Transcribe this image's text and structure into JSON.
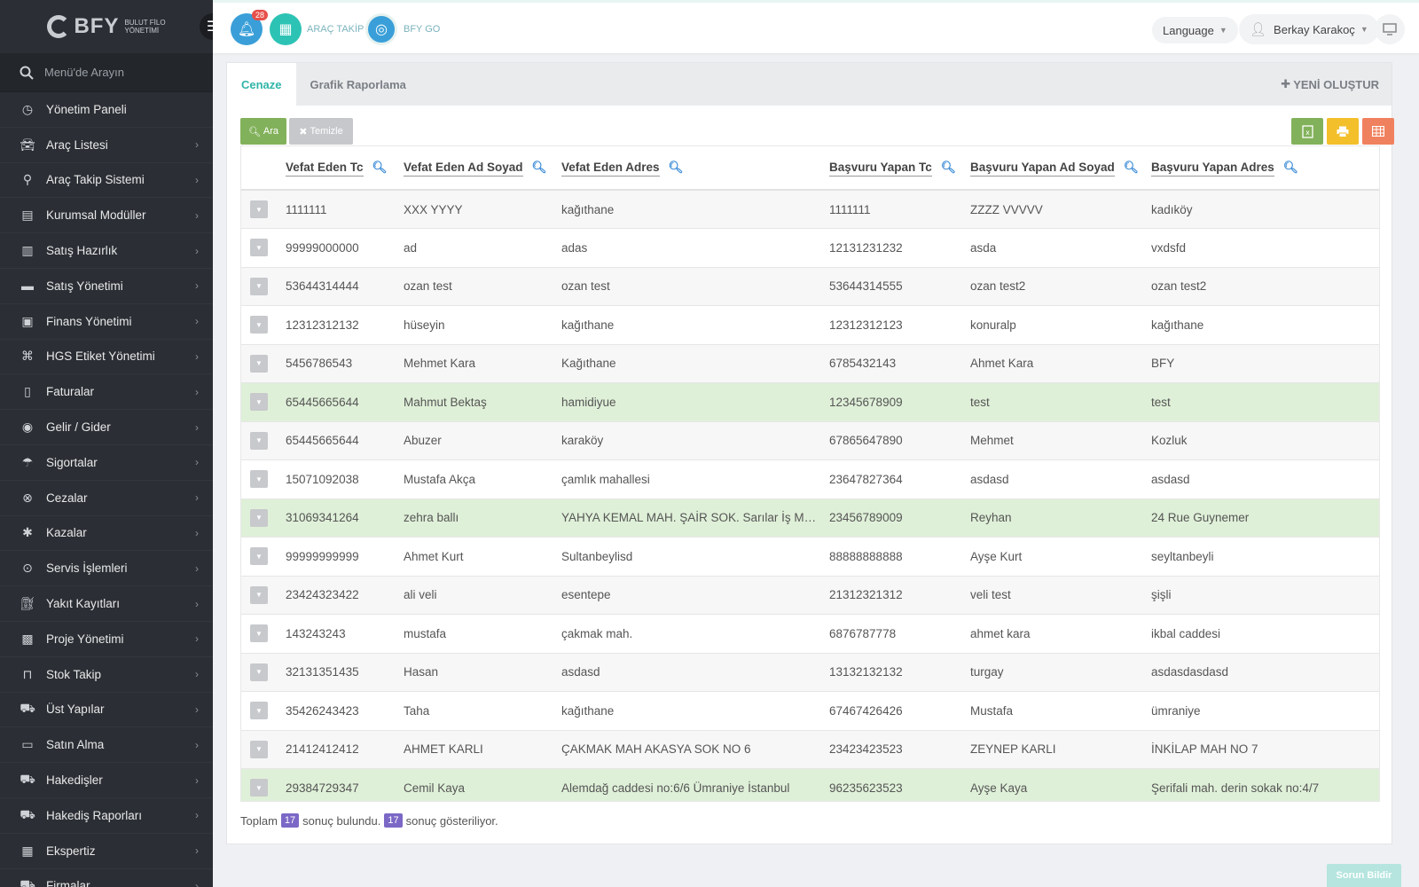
{
  "logo": {
    "text": "BFY",
    "sub1": "BULUT FİLO",
    "sub2": "YÖNETİMİ"
  },
  "sidebar": {
    "search_placeholder": "Menü'de Arayın",
    "items": [
      {
        "label": "Yönetim Paneli",
        "icon": "dashboard-icon",
        "chevron": false
      },
      {
        "label": "Araç Listesi",
        "icon": "car-icon",
        "chevron": true
      },
      {
        "label": "Araç Takip Sistemi",
        "icon": "map-pin-icon",
        "chevron": true
      },
      {
        "label": "Kurumsal Modüller",
        "icon": "server-icon",
        "chevron": true
      },
      {
        "label": "Satış Hazırlık",
        "icon": "book-icon",
        "chevron": true
      },
      {
        "label": "Satış Yönetimi",
        "icon": "card-icon",
        "chevron": true
      },
      {
        "label": "Finans Yönetimi",
        "icon": "money-icon",
        "chevron": true
      },
      {
        "label": "HGS Etiket Yönetimi",
        "icon": "tag-icon",
        "chevron": true
      },
      {
        "label": "Faturalar",
        "icon": "file-icon",
        "chevron": true
      },
      {
        "label": "Gelir / Gider",
        "icon": "coin-icon",
        "chevron": true
      },
      {
        "label": "Sigortalar",
        "icon": "umbrella-icon",
        "chevron": true
      },
      {
        "label": "Cezalar",
        "icon": "x-circle-icon",
        "chevron": true
      },
      {
        "label": "Kazalar",
        "icon": "car-crash-icon",
        "chevron": true
      },
      {
        "label": "Servis İşlemleri",
        "icon": "check-circle-icon",
        "chevron": true
      },
      {
        "label": "Yakıt Kayıtları",
        "icon": "fuel-icon",
        "chevron": true
      },
      {
        "label": "Proje Yönetimi",
        "icon": "briefcase-icon",
        "chevron": true
      },
      {
        "label": "Stok Takip",
        "icon": "inbox-icon",
        "chevron": true
      },
      {
        "label": "Üst Yapılar",
        "icon": "truck-icon",
        "chevron": true
      },
      {
        "label": "Satın Alma",
        "icon": "credit-card-icon",
        "chevron": true
      },
      {
        "label": "Hakedişler",
        "icon": "truck-icon",
        "chevron": true
      },
      {
        "label": "Hakediş Raporları",
        "icon": "truck-icon",
        "chevron": true
      },
      {
        "label": "Ekspertiz",
        "icon": "report-icon",
        "chevron": true
      },
      {
        "label": "Firmalar",
        "icon": "truck-icon",
        "chevron": true
      }
    ]
  },
  "topbar": {
    "notification_count": "28",
    "arac_takip_label": "ARAÇ TAKİP",
    "bfy_go_label": "BFY GO",
    "language_label": "Language",
    "user_name": "Berkay Karakoç"
  },
  "tabs": [
    {
      "label": "Cenaze",
      "active": true
    },
    {
      "label": "Grafik Raporlama",
      "active": false
    }
  ],
  "new_button_label": "YENİ OLUŞTUR",
  "toolbar": {
    "search_label": "Ara",
    "clear_label": "Temizle"
  },
  "table": {
    "columns": [
      "Vefat Eden Tc",
      "Vefat Eden Ad Soyad",
      "Vefat Eden Adres",
      "Başvuru Yapan Tc",
      "Başvuru Yapan Ad Soyad",
      "Başvuru Yapan Adres"
    ],
    "rows": [
      {
        "cells": [
          "1111111",
          "XXX YYYY",
          "kağıthane",
          "1111111",
          "ZZZZ VVVVV",
          "kadıköy"
        ],
        "highlight": false
      },
      {
        "cells": [
          "99999000000",
          "ad",
          "adas",
          "12131231232",
          "asda",
          "vxdsfd"
        ],
        "highlight": false
      },
      {
        "cells": [
          "53644314444",
          "ozan test",
          "ozan test",
          "53644314555",
          "ozan test2",
          "ozan test2"
        ],
        "highlight": false
      },
      {
        "cells": [
          "12312312132",
          "hüseyin",
          "kağıthane",
          "12312312123",
          "konuralp",
          "kağıthane"
        ],
        "highlight": false
      },
      {
        "cells": [
          "5456786543",
          "Mehmet Kara",
          "Kağıthane",
          "6785432143",
          "Ahmet Kara",
          "BFY"
        ],
        "highlight": false
      },
      {
        "cells": [
          "65445665644",
          "Mahmut Bektaş",
          "hamidiyue",
          "12345678909",
          "test",
          "test"
        ],
        "highlight": true
      },
      {
        "cells": [
          "65445665644",
          "Abuzer",
          "karaköy",
          "67865647890",
          "Mehmet",
          "Kozluk"
        ],
        "highlight": false
      },
      {
        "cells": [
          "15071092038",
          "Mustafa Akça",
          "çamlık mahallesi",
          "23647827364",
          "asdasd",
          "asdasd"
        ],
        "highlight": false
      },
      {
        "cells": [
          "31069341264",
          "zehra ballı",
          "YAHYA KEMAL MAH. ŞAİR SOK. Sarılar İş Merkezi",
          "23456789009",
          "Reyhan",
          "24 Rue Guynemer"
        ],
        "highlight": true
      },
      {
        "cells": [
          "99999999999",
          "Ahmet Kurt",
          "Sultanbeylisd",
          "88888888888",
          "Ayşe Kurt",
          "seyltanbeyli"
        ],
        "highlight": false
      },
      {
        "cells": [
          "23424323422",
          "ali veli",
          "esentepe",
          "21312321312",
          "veli test",
          "şişli"
        ],
        "highlight": false
      },
      {
        "cells": [
          "143243243",
          "mustafa",
          "çakmak mah.",
          "6876787778",
          "ahmet kara",
          "ikbal caddesi"
        ],
        "highlight": false
      },
      {
        "cells": [
          "32131351435",
          "Hasan",
          "asdasd",
          "13132132132",
          "turgay",
          "asdasdasdasd"
        ],
        "highlight": false
      },
      {
        "cells": [
          "35426243423",
          "Taha",
          "kağıthane",
          "67467426426",
          "Mustafa",
          "ümraniye"
        ],
        "highlight": false
      },
      {
        "cells": [
          "21412412412",
          "AHMET KARLI",
          "ÇAKMAK MAH AKASYA SOK NO 6",
          "23423423523",
          "ZEYNEP KARLI",
          "İNKİLAP MAH NO 7"
        ],
        "highlight": false
      },
      {
        "cells": [
          "29384729347",
          "Cemil Kaya",
          "Alemdağ caddesi no:6/6 Ümraniye İstanbul",
          "96235623523",
          "Ayşe Kaya",
          "Şerifali mah. derin sokak no:4/7"
        ],
        "highlight": true
      }
    ]
  },
  "footer": {
    "prefix": "Toplam",
    "total": "17",
    "middle": "sonuç bulundu.",
    "shown": "17",
    "suffix": "sonuç gösteriliyor."
  },
  "report_button_label": "Sorun Bildir",
  "colors": {
    "accent": "#2fb5a8",
    "sidebar_bg": "#2b2f35",
    "search_btn": "#82b15b",
    "excel_btn": "#82b15b",
    "print_btn": "#f3bf2b",
    "columns_btn": "#f0815e",
    "highlight_row": "#dff0d8"
  }
}
